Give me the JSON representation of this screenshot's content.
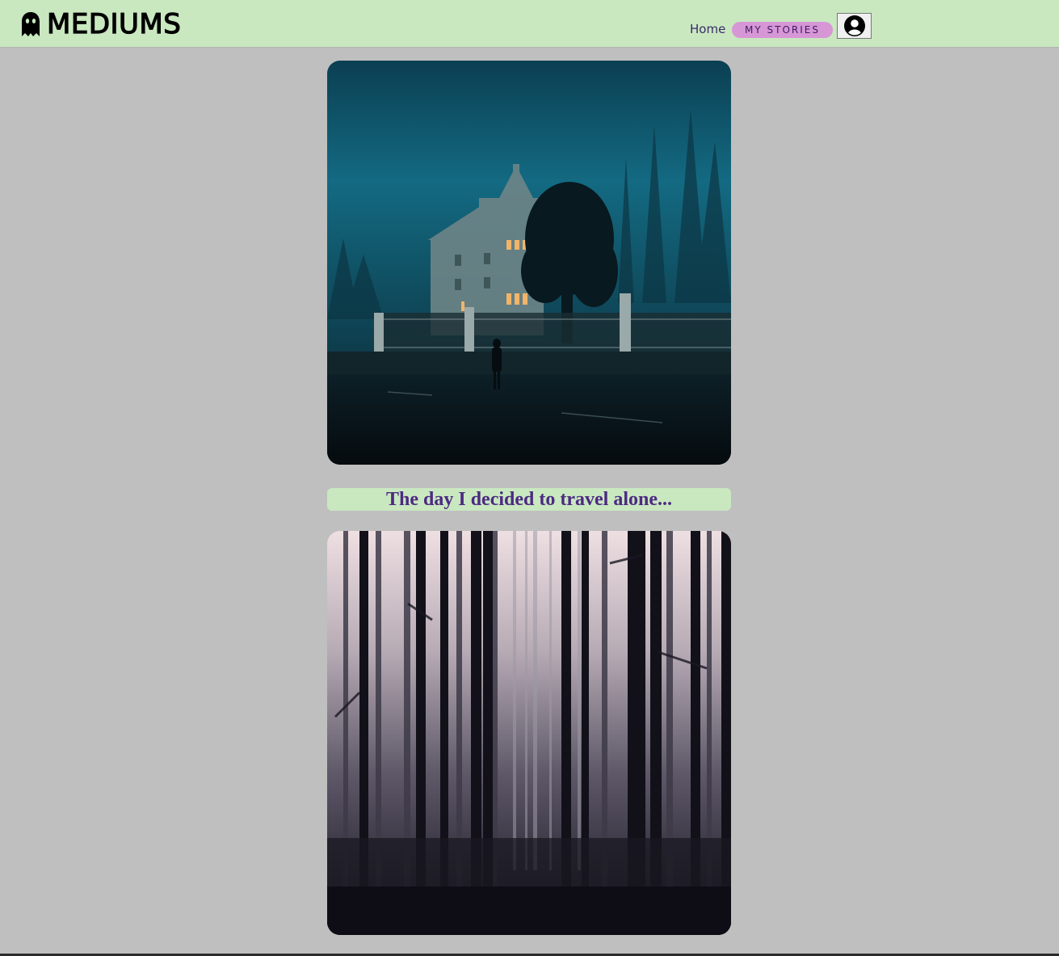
{
  "brand": {
    "name": "MEDIUMS",
    "icon": "ghost-icon"
  },
  "nav": {
    "home_label": "Home",
    "stories_label": "MY STORIES",
    "profile_icon": "user-circle-icon"
  },
  "stories": [
    {
      "image": "haunted-house-in-fog",
      "title": "The day I decided to travel alone..."
    },
    {
      "image": "foggy-dark-forest",
      "title": ""
    }
  ],
  "colors": {
    "navbar_bg": "#c9e8c0",
    "page_bg": "#bfbfbf",
    "stories_pill": "#d796d6",
    "title_text": "#4d2a82",
    "home_text": "#3a2a6a"
  }
}
